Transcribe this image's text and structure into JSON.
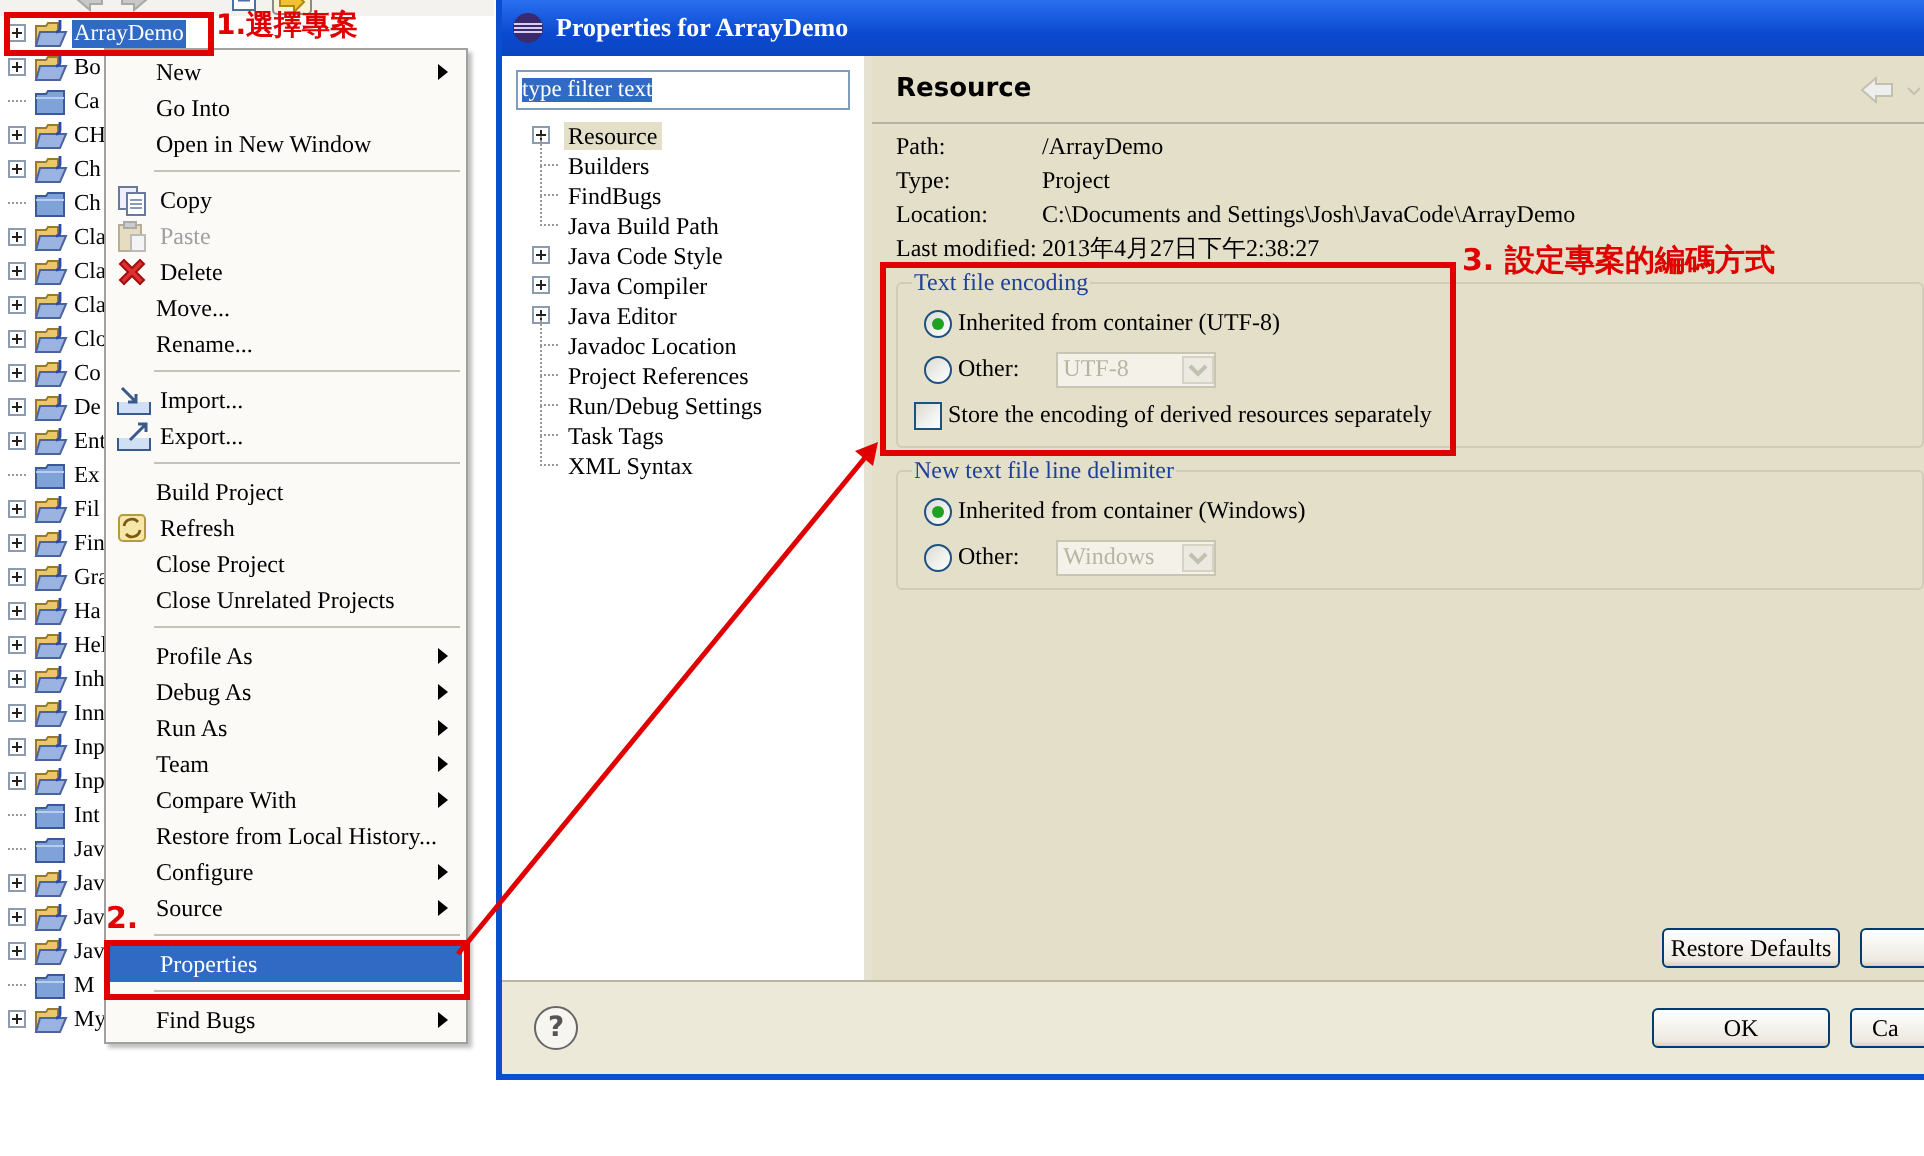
{
  "project_explorer": {
    "items": [
      {
        "label": "ArrayDemo",
        "kind": "project",
        "selected": true
      },
      {
        "label": "Bo",
        "kind": "project",
        "selected": false
      },
      {
        "label": "Ca",
        "kind": "folder",
        "selected": false
      },
      {
        "label": "CH",
        "kind": "project",
        "selected": false
      },
      {
        "label": "Ch",
        "kind": "project",
        "selected": false
      },
      {
        "label": "Ch",
        "kind": "folder",
        "selected": false
      },
      {
        "label": "Cla",
        "kind": "project",
        "selected": false
      },
      {
        "label": "Cla",
        "kind": "project",
        "selected": false
      },
      {
        "label": "Cla",
        "kind": "project",
        "selected": false
      },
      {
        "label": "Clo",
        "kind": "project",
        "selected": false
      },
      {
        "label": "Co",
        "kind": "project",
        "selected": false
      },
      {
        "label": "De",
        "kind": "project",
        "selected": false
      },
      {
        "label": "Ent",
        "kind": "project",
        "selected": false
      },
      {
        "label": "Ex",
        "kind": "folder",
        "selected": false
      },
      {
        "label": "Fil",
        "kind": "project",
        "selected": false
      },
      {
        "label": "Fin",
        "kind": "project",
        "selected": false
      },
      {
        "label": "Gra",
        "kind": "project",
        "selected": false
      },
      {
        "label": "Ha",
        "kind": "project",
        "selected": false
      },
      {
        "label": "Hel",
        "kind": "project",
        "selected": false
      },
      {
        "label": "Inh",
        "kind": "project",
        "selected": false
      },
      {
        "label": "Inn",
        "kind": "project",
        "selected": false
      },
      {
        "label": "Inp",
        "kind": "project",
        "selected": false
      },
      {
        "label": "Inp",
        "kind": "project",
        "selected": false
      },
      {
        "label": "Int",
        "kind": "folder",
        "selected": false
      },
      {
        "label": "Jav",
        "kind": "folder",
        "selected": false
      },
      {
        "label": "Jav",
        "kind": "project",
        "selected": false
      },
      {
        "label": "Jav",
        "kind": "project",
        "selected": false
      },
      {
        "label": "Jav",
        "kind": "project",
        "selected": false
      },
      {
        "label": "M",
        "kind": "folder",
        "selected": false
      },
      {
        "label": "My",
        "kind": "project",
        "selected": false
      }
    ]
  },
  "context_menu": {
    "groups": [
      [
        {
          "label": "New",
          "submenu": true,
          "disabled": false,
          "selected": false
        },
        {
          "label": "Go Into",
          "submenu": false,
          "disabled": false,
          "selected": false
        },
        {
          "label": "Open in New Window",
          "submenu": false,
          "disabled": false,
          "selected": false
        }
      ],
      [
        {
          "label": "Copy",
          "submenu": false,
          "disabled": false,
          "selected": false
        },
        {
          "label": "Paste",
          "submenu": false,
          "disabled": true,
          "selected": false
        },
        {
          "label": "Delete",
          "submenu": false,
          "disabled": false,
          "selected": false
        },
        {
          "label": "Move...",
          "submenu": false,
          "disabled": false,
          "selected": false
        },
        {
          "label": "Rename...",
          "submenu": false,
          "disabled": false,
          "selected": false
        }
      ],
      [
        {
          "label": "Import...",
          "submenu": false,
          "disabled": false,
          "selected": false
        },
        {
          "label": "Export...",
          "submenu": false,
          "disabled": false,
          "selected": false
        }
      ],
      [
        {
          "label": "Build Project",
          "submenu": false,
          "disabled": false,
          "selected": false
        },
        {
          "label": "Refresh",
          "submenu": false,
          "disabled": false,
          "selected": false
        },
        {
          "label": "Close Project",
          "submenu": false,
          "disabled": false,
          "selected": false
        },
        {
          "label": "Close Unrelated Projects",
          "submenu": false,
          "disabled": false,
          "selected": false
        }
      ],
      [
        {
          "label": "Profile As",
          "submenu": true,
          "disabled": false,
          "selected": false
        },
        {
          "label": "Debug As",
          "submenu": true,
          "disabled": false,
          "selected": false
        },
        {
          "label": "Run As",
          "submenu": true,
          "disabled": false,
          "selected": false
        },
        {
          "label": "Team",
          "submenu": true,
          "disabled": false,
          "selected": false
        },
        {
          "label": "Compare With",
          "submenu": true,
          "disabled": false,
          "selected": false
        },
        {
          "label": "Restore from Local History...",
          "submenu": false,
          "disabled": false,
          "selected": false
        },
        {
          "label": "Configure",
          "submenu": true,
          "disabled": false,
          "selected": false
        },
        {
          "label": "Source",
          "submenu": true,
          "disabled": false,
          "selected": false
        }
      ],
      [
        {
          "label": "Properties",
          "submenu": false,
          "disabled": false,
          "selected": true
        }
      ],
      [
        {
          "label": "Find Bugs",
          "submenu": true,
          "disabled": false,
          "selected": false
        }
      ]
    ]
  },
  "dialog": {
    "title": "Properties for ArrayDemo",
    "filter": {
      "value": "type filter text",
      "selected": true
    },
    "tree": [
      {
        "label": "Resource",
        "expandable": true,
        "selected": true
      },
      {
        "label": "Builders",
        "expandable": false,
        "selected": false
      },
      {
        "label": "FindBugs",
        "expandable": false,
        "selected": false
      },
      {
        "label": "Java Build Path",
        "expandable": false,
        "selected": false
      },
      {
        "label": "Java Code Style",
        "expandable": true,
        "selected": false
      },
      {
        "label": "Java Compiler",
        "expandable": true,
        "selected": false
      },
      {
        "label": "Java Editor",
        "expandable": true,
        "selected": false
      },
      {
        "label": "Javadoc Location",
        "expandable": false,
        "selected": false
      },
      {
        "label": "Project References",
        "expandable": false,
        "selected": false
      },
      {
        "label": "Run/Debug Settings",
        "expandable": false,
        "selected": false
      },
      {
        "label": "Task Tags",
        "expandable": false,
        "selected": false
      },
      {
        "label": "XML Syntax",
        "expandable": false,
        "selected": false
      }
    ],
    "page_title": "Resource",
    "info": [
      {
        "label": "Path:",
        "value": "/ArrayDemo"
      },
      {
        "label": "Type:",
        "value": "Project"
      },
      {
        "label": "Location:",
        "value": "C:\\Documents and Settings\\Josh\\JavaCode\\ArrayDemo"
      },
      {
        "label": "Last modified:",
        "value": "2013年4月27日下午2:38:27"
      }
    ],
    "groups": [
      {
        "legend": "Text file encoding",
        "options": [
          {
            "kind": "radio",
            "label": "Inherited from container (UTF-8)",
            "selected": true
          },
          {
            "kind": "radio",
            "label": "Other:",
            "selected": false,
            "combo": {
              "value": "UTF-8",
              "disabled": true
            }
          },
          {
            "kind": "checkbox",
            "label": "Store the encoding of derived resources separately",
            "checked": false
          }
        ]
      },
      {
        "legend": "New text file line delimiter",
        "options": [
          {
            "kind": "radio",
            "label": "Inherited from container (Windows)",
            "selected": true
          },
          {
            "kind": "radio",
            "label": "Other:",
            "selected": false,
            "combo": {
              "value": "Windows",
              "disabled": true
            }
          }
        ]
      }
    ],
    "restore_button": "Restore Defaults",
    "help": "?",
    "ok_button": "OK",
    "cancel_button": "Ca"
  },
  "annotations": [
    {
      "text": "1.選擇專案"
    },
    {
      "text": "2."
    },
    {
      "text": "3. 設定專案的編碼方式"
    }
  ]
}
